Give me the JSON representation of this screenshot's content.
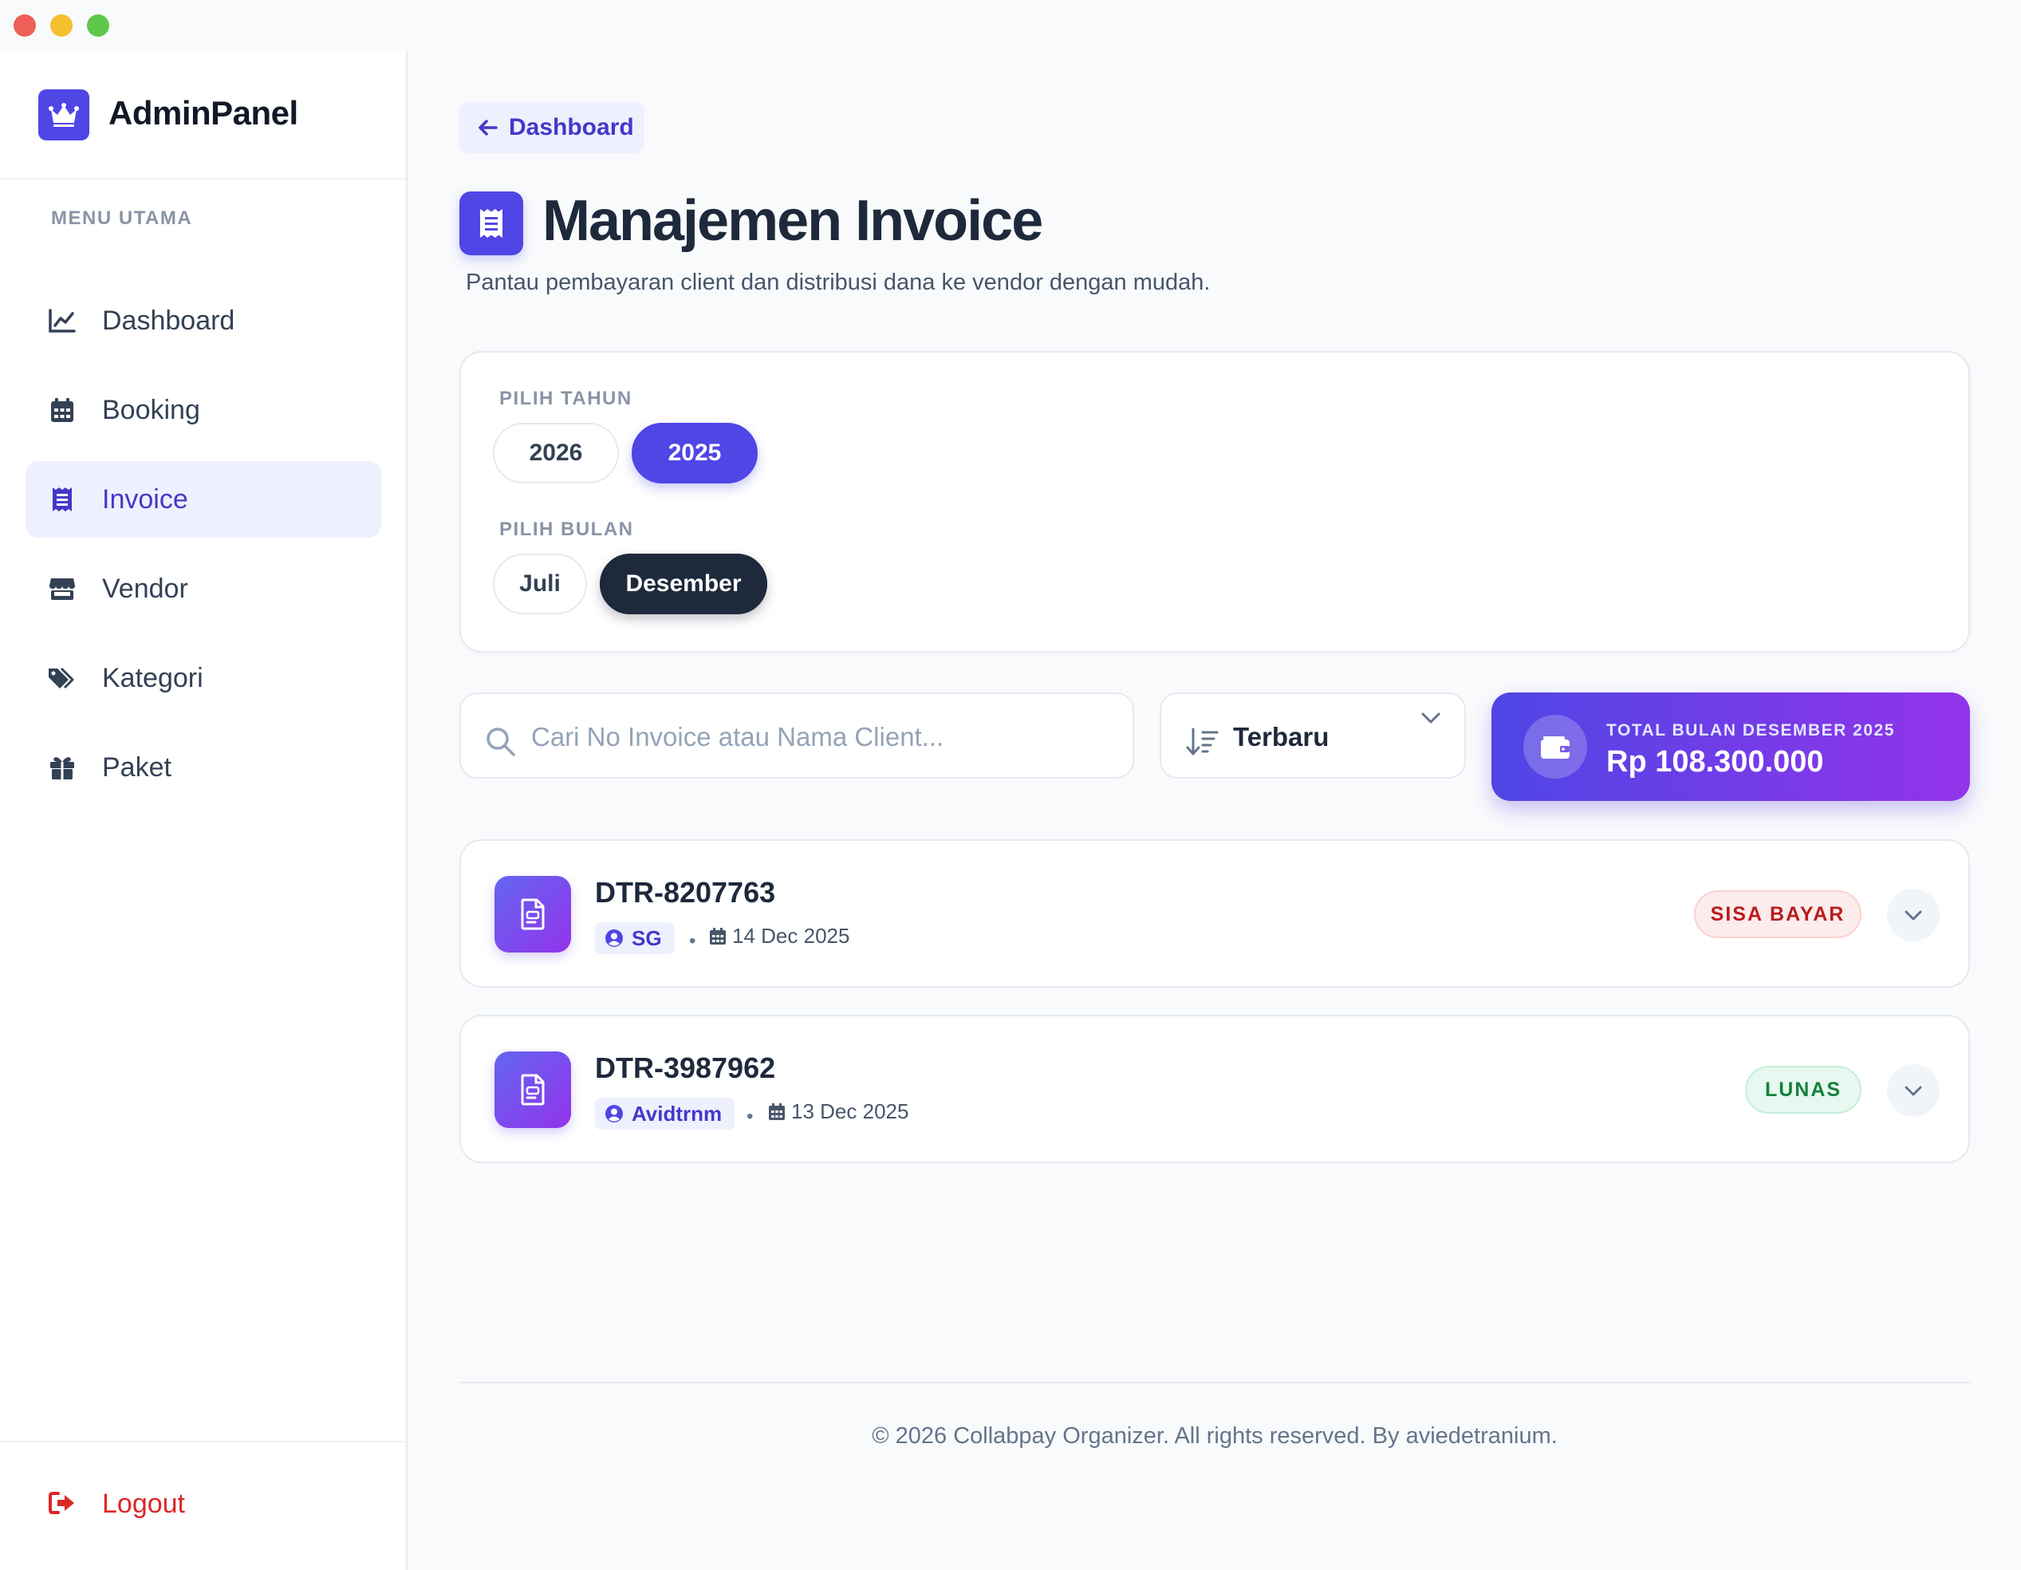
{
  "brand": {
    "name": "AdminPanel",
    "logo_icon": "crown-icon",
    "accent": "#4f46e5"
  },
  "sidebar": {
    "section_title": "MENU UTAMA",
    "items": [
      {
        "label": "Dashboard",
        "icon": "chart-line-icon",
        "active": false
      },
      {
        "label": "Booking",
        "icon": "calendar-icon",
        "active": false
      },
      {
        "label": "Invoice",
        "icon": "receipt-icon",
        "active": true
      },
      {
        "label": "Vendor",
        "icon": "store-icon",
        "active": false
      },
      {
        "label": "Kategori",
        "icon": "tags-icon",
        "active": false
      },
      {
        "label": "Paket",
        "icon": "gift-icon",
        "active": false
      }
    ],
    "logout_label": "Logout"
  },
  "back_button": {
    "label": "Dashboard"
  },
  "page": {
    "title": "Manajemen Invoice",
    "subtitle": "Pantau pembayaran client dan distribusi dana ke vendor dengan mudah."
  },
  "filters": {
    "year_label": "PILIH TAHUN",
    "years": [
      "2026",
      "2025"
    ],
    "selected_year": "2025",
    "month_label": "PILIH BULAN",
    "months": [
      "Juli",
      "Desember"
    ],
    "selected_month": "Desember"
  },
  "search": {
    "placeholder": "Cari No Invoice atau Nama Client...",
    "value": ""
  },
  "sort": {
    "selected": "Terbaru"
  },
  "total": {
    "label": "TOTAL BULAN DESEMBER 2025",
    "value": "Rp 108.300.000"
  },
  "invoices": [
    {
      "number": "DTR-8207763",
      "client": "SG",
      "date": "14 Dec 2025",
      "status": "SISA BAYAR",
      "status_color": "#b91c1c"
    },
    {
      "number": "DTR-3987962",
      "client": "Avidtrnm",
      "date": "13 Dec 2025",
      "status": "LUNAS",
      "status_color": "#15803d"
    }
  ],
  "footer": {
    "text": "© 2026 Collabpay Organizer. All rights reserved. By aviedetranium."
  }
}
